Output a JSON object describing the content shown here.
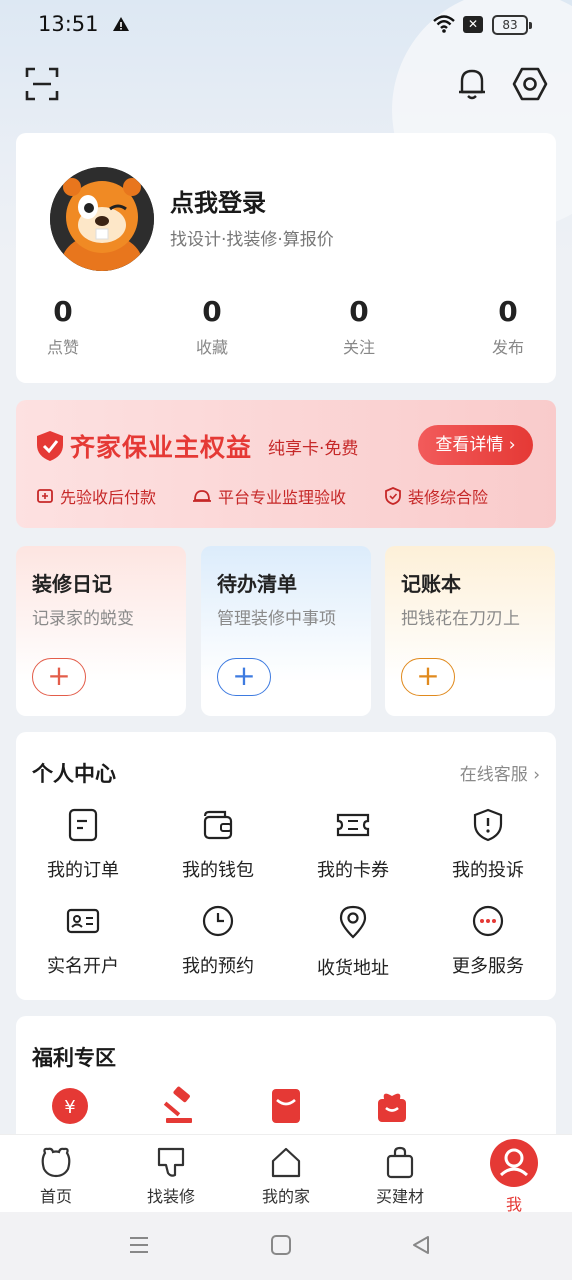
{
  "status_bar": {
    "time": "13:51",
    "battery": "83"
  },
  "header": {
    "scan_icon": "scan-icon",
    "bell_icon": "bell-icon",
    "settings_icon": "gear-icon"
  },
  "profile": {
    "title": "点我登录",
    "subtitle": "找设计·找装修·算报价",
    "stats": [
      {
        "value": "0",
        "label": "点赞"
      },
      {
        "value": "0",
        "label": "收藏"
      },
      {
        "value": "0",
        "label": "关注"
      },
      {
        "value": "0",
        "label": "发布"
      }
    ]
  },
  "rights": {
    "title": "齐家保业主权益",
    "tag": "纯享卡·免费",
    "button": "查看详情 ›",
    "benefits": [
      "先验收后付款",
      "平台专业监理验收",
      "装修综合险"
    ]
  },
  "tools": [
    {
      "title": "装修日记",
      "subtitle": "记录家的蜕变",
      "plus": "+"
    },
    {
      "title": "待办清单",
      "subtitle": "管理装修中事项",
      "plus": "+"
    },
    {
      "title": "记账本",
      "subtitle": "把钱花在刀刃上",
      "plus": "+"
    }
  ],
  "personal_center": {
    "title": "个人中心",
    "link": "在线客服 ›",
    "items": [
      {
        "label": "我的订单",
        "icon": "order-icon"
      },
      {
        "label": "我的钱包",
        "icon": "wallet-icon"
      },
      {
        "label": "我的卡券",
        "icon": "coupon-icon"
      },
      {
        "label": "我的投诉",
        "icon": "complaint-icon"
      },
      {
        "label": "实名开户",
        "icon": "id-card-icon"
      },
      {
        "label": "我的预约",
        "icon": "clock-icon"
      },
      {
        "label": "收货地址",
        "icon": "location-icon"
      },
      {
        "label": "更多服务",
        "icon": "more-icon"
      }
    ]
  },
  "welfare": {
    "title": "福利专区"
  },
  "tabbar": [
    {
      "label": "首页",
      "icon": "home-bear-icon"
    },
    {
      "label": "找装修",
      "icon": "thumb-icon"
    },
    {
      "label": "我的家",
      "icon": "house-icon"
    },
    {
      "label": "买建材",
      "icon": "bag-icon"
    },
    {
      "label": "我",
      "icon": "me-avatar-icon",
      "active": true
    }
  ],
  "colors": {
    "accent": "#e53935",
    "blue": "#3e7be0",
    "orange": "#e08a1e"
  }
}
